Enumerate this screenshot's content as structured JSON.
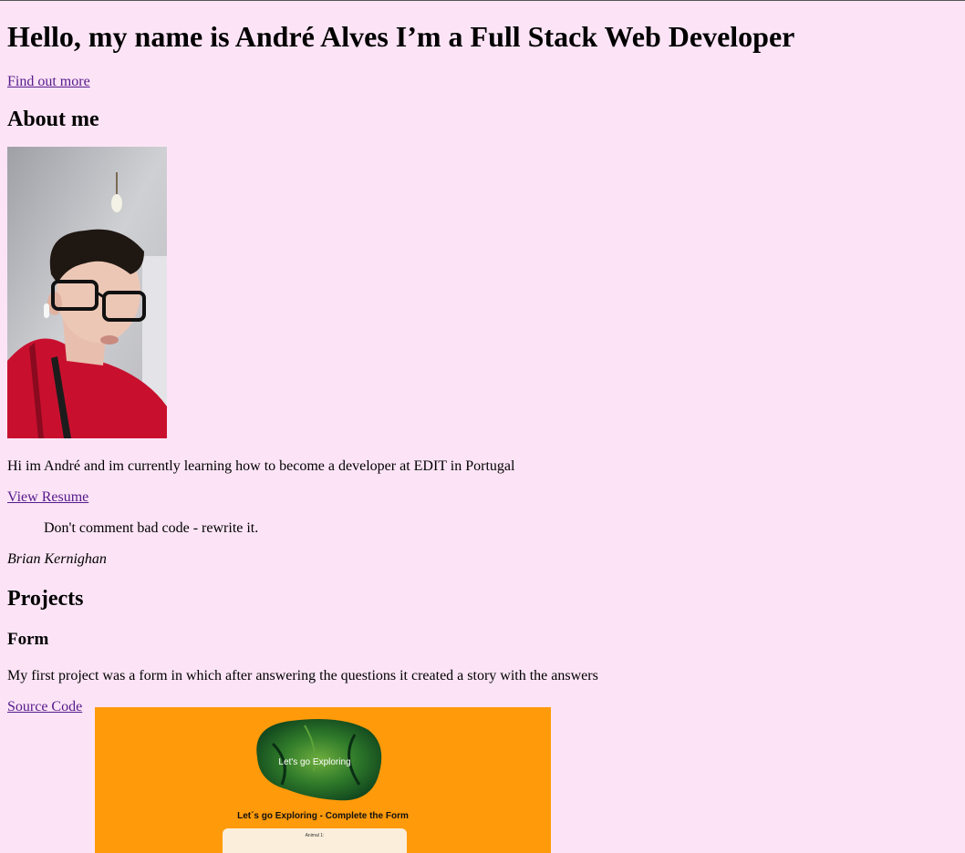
{
  "header": {
    "title": "Hello, my name is André Alves I’m a Full Stack Web Developer",
    "find_out_more": "Find out more"
  },
  "about": {
    "title": "About me",
    "intro": "Hi im André and im currently learning how to become a developer at EDIT in Portugal",
    "resume_link": "View Resume",
    "quote": "Don't comment bad code - rewrite it.",
    "quote_author": "Brian Kernighan"
  },
  "projects": {
    "title": "Projects",
    "items": [
      {
        "title": "Form",
        "description": "My first project was a form in which after answering the questions it created a story with the answers",
        "source_link": "Source Code",
        "preview": {
          "blob_text": "Let's go Exploring",
          "caption": "Let´s go Exploring - Complete the Form",
          "card_label": "Animal 1:"
        }
      }
    ]
  },
  "colors": {
    "background": "#fce4f6",
    "link": "#551a8b",
    "preview_background": "#ff9a0a"
  }
}
